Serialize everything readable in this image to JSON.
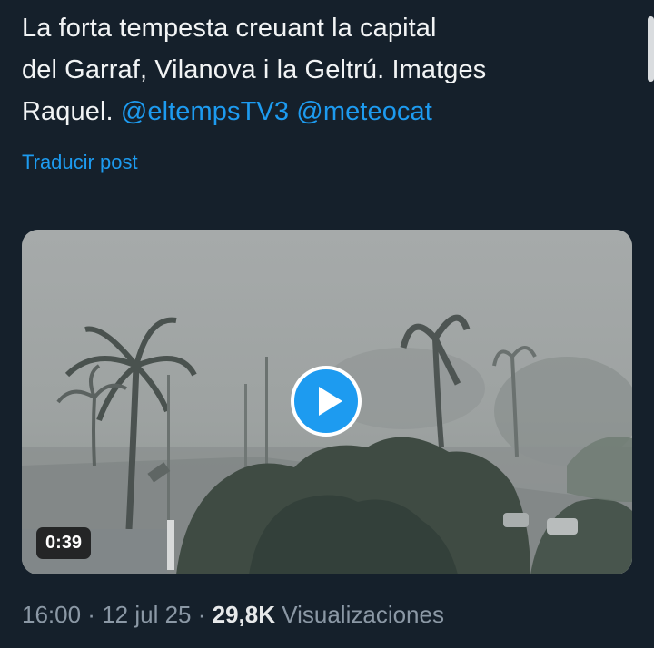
{
  "tweet": {
    "text_lines": [
      "La forta tempesta creuant la capital",
      "del Garraf, Vilanova i la Geltrú. Imatges",
      "Raquel. "
    ],
    "mention_1": "@eltempsTV3",
    "mention_2": "@meteocat",
    "translate_label": "Traducir post"
  },
  "video": {
    "duration": "0:39",
    "play_icon": "play-icon"
  },
  "meta": {
    "time": "16:00",
    "separator": " · ",
    "date": "12 jul 25",
    "views_count": "29,8K",
    "views_label": "Visualizaciones"
  },
  "colors": {
    "background": "#15202b",
    "accent": "#1d9bf0",
    "secondary_text": "#8b98a5"
  }
}
